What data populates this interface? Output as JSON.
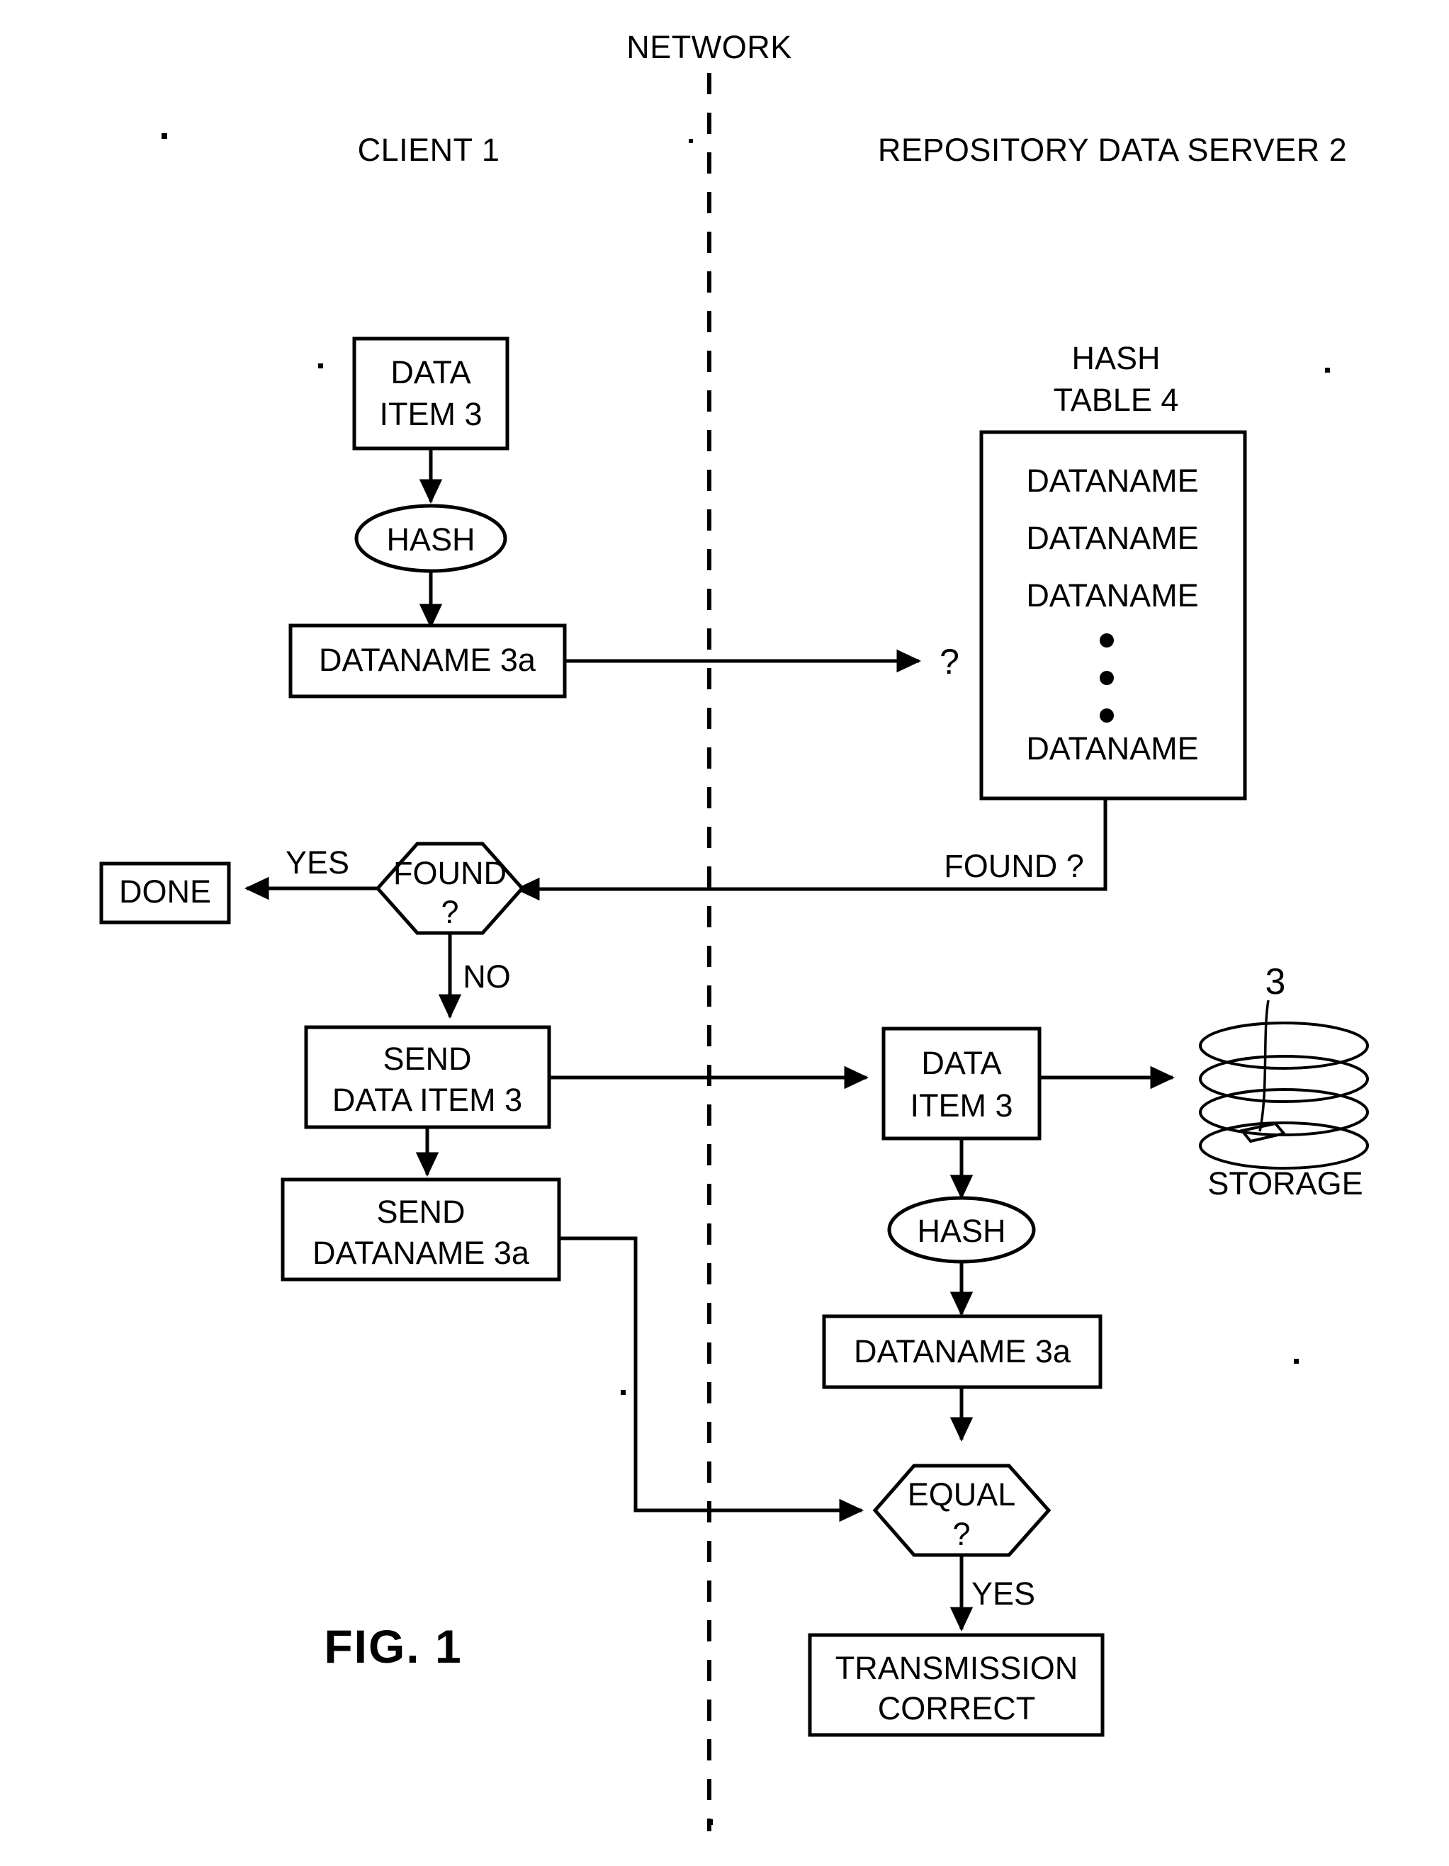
{
  "figure": {
    "label": "FIG. 1",
    "network_divider_label": "NETWORK",
    "columns": {
      "left": "CLIENT 1",
      "right": "REPOSITORY DATA SERVER 2"
    }
  },
  "client": {
    "data_item_line1": "DATA",
    "data_item_line2": "ITEM 3",
    "hash": "HASH",
    "dataname": "DATANAME 3a",
    "done": "DONE",
    "found_line1": "FOUND",
    "found_line2": "?",
    "found_yes": "YES",
    "found_no": "NO",
    "send_data_item_line1": "SEND",
    "send_data_item_line2": "DATA ITEM 3",
    "send_dataname_line1": "SEND",
    "send_dataname_line2": "DATANAME 3a"
  },
  "server": {
    "hash_table_title_line1": "HASH",
    "hash_table_title_line2": "TABLE 4",
    "query_marker": "?",
    "hash_table_entries": [
      "DATANAME",
      "DATANAME",
      "DATANAME",
      "DATANAME"
    ],
    "hash_table_ellipsis": "•",
    "found_query_label": "FOUND ?",
    "data_item_line1": "DATA",
    "data_item_line2": "ITEM 3",
    "storage_label": "STORAGE",
    "storage_callout": "3",
    "hash": "HASH",
    "dataname": "DATANAME 3a",
    "equal_line1": "EQUAL",
    "equal_line2": "?",
    "equal_yes": "YES",
    "transmission_line1": "TRANSMISSION",
    "transmission_line2": "CORRECT"
  }
}
